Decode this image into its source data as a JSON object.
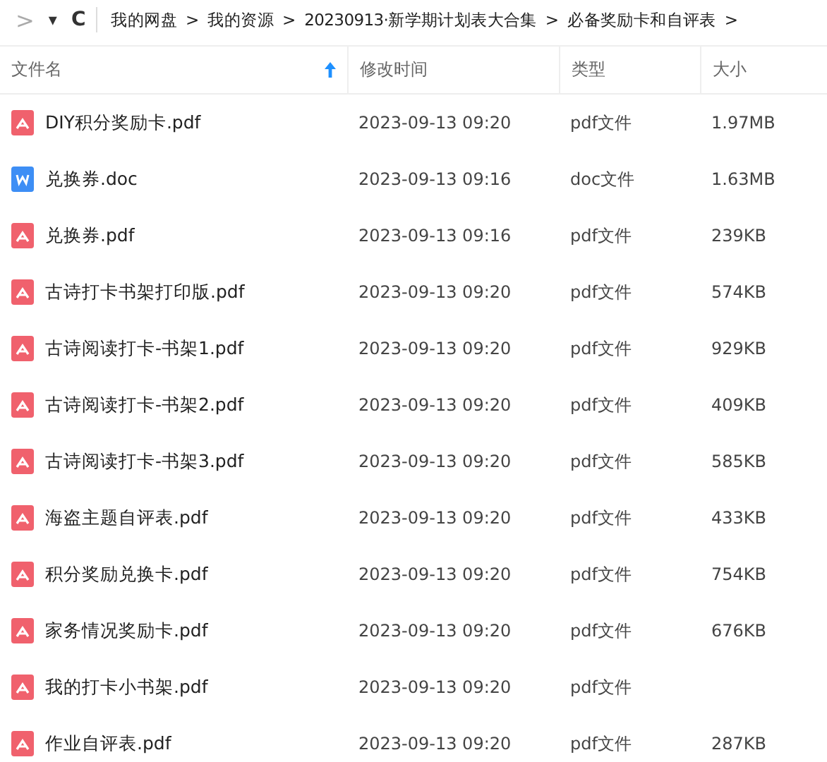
{
  "nav": {
    "forward": ">",
    "menu": "▾",
    "refresh": "C"
  },
  "breadcrumb": [
    "我的网盘",
    "我的资源",
    "20230913·新学期计划表大合集",
    "必备奖励卡和自评表"
  ],
  "breadcrumb_separator": ">",
  "columns": [
    {
      "label": "文件名",
      "sorted": true
    },
    {
      "label": "修改时间",
      "sorted": false
    },
    {
      "label": "类型",
      "sorted": false
    },
    {
      "label": "大小",
      "sorted": false
    }
  ],
  "files": [
    {
      "kind": "pdf",
      "name": "DIY积分奖励卡.pdf",
      "modified": "2023-09-13 09:20",
      "type": "pdf文件",
      "size": "1.97MB"
    },
    {
      "kind": "doc",
      "name": "兑换券.doc",
      "modified": "2023-09-13 09:16",
      "type": "doc文件",
      "size": "1.63MB"
    },
    {
      "kind": "pdf",
      "name": "兑换券.pdf",
      "modified": "2023-09-13 09:16",
      "type": "pdf文件",
      "size": "239KB"
    },
    {
      "kind": "pdf",
      "name": "古诗打卡书架打印版.pdf",
      "modified": "2023-09-13 09:20",
      "type": "pdf文件",
      "size": "574KB"
    },
    {
      "kind": "pdf",
      "name": "古诗阅读打卡-书架1.pdf",
      "modified": "2023-09-13 09:20",
      "type": "pdf文件",
      "size": "929KB"
    },
    {
      "kind": "pdf",
      "name": "古诗阅读打卡-书架2.pdf",
      "modified": "2023-09-13 09:20",
      "type": "pdf文件",
      "size": "409KB"
    },
    {
      "kind": "pdf",
      "name": "古诗阅读打卡-书架3.pdf",
      "modified": "2023-09-13 09:20",
      "type": "pdf文件",
      "size": "585KB"
    },
    {
      "kind": "pdf",
      "name": "海盗主题自评表.pdf",
      "modified": "2023-09-13 09:20",
      "type": "pdf文件",
      "size": "433KB"
    },
    {
      "kind": "pdf",
      "name": "积分奖励兑换卡.pdf",
      "modified": "2023-09-13 09:20",
      "type": "pdf文件",
      "size": "754KB"
    },
    {
      "kind": "pdf",
      "name": "家务情况奖励卡.pdf",
      "modified": "2023-09-13 09:20",
      "type": "pdf文件",
      "size": "676KB"
    },
    {
      "kind": "pdf",
      "name": "我的打卡小书架.pdf",
      "modified": "2023-09-13 09:20",
      "type": "pdf文件"
    },
    {
      "kind": "pdf",
      "name": "作业自评表.pdf",
      "modified": "2023-09-13 09:20",
      "type": "pdf文件",
      "size": "287KB"
    }
  ]
}
